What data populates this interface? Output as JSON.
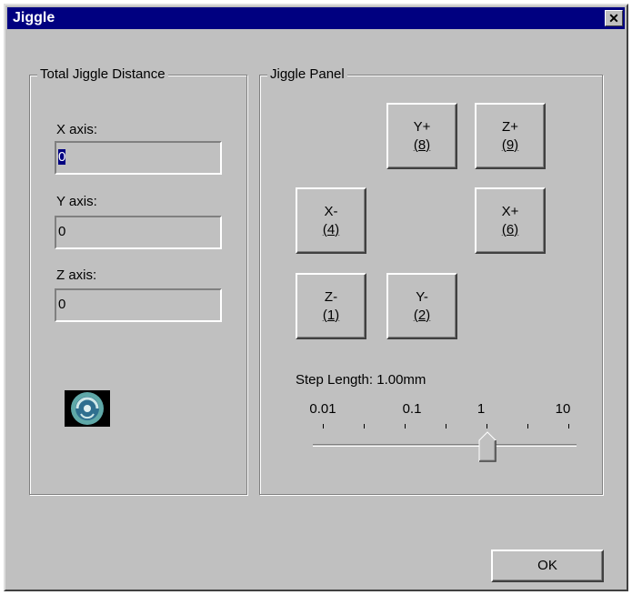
{
  "window": {
    "title": "Jiggle",
    "close_glyph": "✕"
  },
  "total_group": {
    "legend": "Total Jiggle Distance",
    "x_label": "X axis:",
    "x_value": "0",
    "y_label": "Y axis:",
    "y_value": "0",
    "z_label": "Z axis:",
    "z_value": "0"
  },
  "jiggle_panel": {
    "legend": "Jiggle Panel",
    "buttons": {
      "y_plus": {
        "label": "Y+",
        "key": "(8)"
      },
      "z_plus": {
        "label": "Z+",
        "key": "(9)"
      },
      "x_minus": {
        "label": "X-",
        "key": "(4)"
      },
      "x_plus": {
        "label": "X+",
        "key": "(6)"
      },
      "z_minus": {
        "label": "Z-",
        "key": "(1)"
      },
      "y_minus": {
        "label": "Y-",
        "key": "(2)"
      }
    },
    "step_length": {
      "label": "Step Length: 1.00mm",
      "scale_labels": [
        "0.01",
        "0.1",
        "1",
        "10"
      ],
      "selected_value": "1"
    }
  },
  "footer": {
    "ok_label": "OK"
  },
  "icons": {
    "logo": "logo-icon"
  },
  "colors": {
    "title_bar": "#000080",
    "face": "#c0c0c0",
    "selection": "#000080"
  }
}
